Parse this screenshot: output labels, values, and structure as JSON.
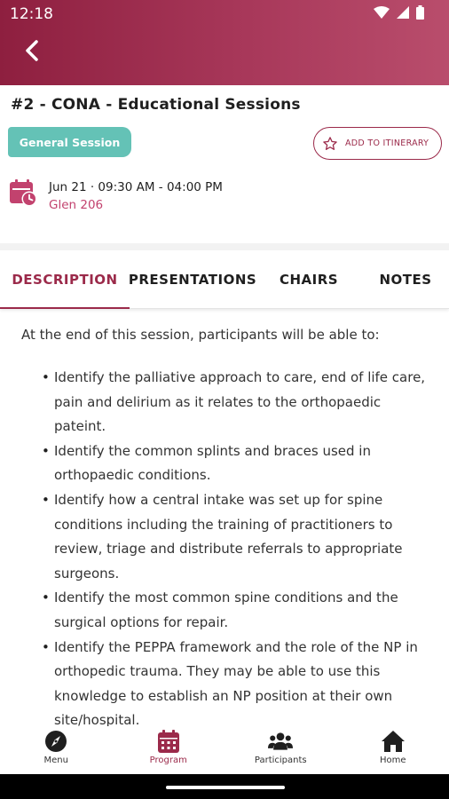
{
  "status_bar": {
    "time": "12:18"
  },
  "session": {
    "title": "#2 - CONA - Educational Sessions",
    "badge": "General Session",
    "itinerary_button": "ADD TO ITINERARY",
    "datetime": "Jun 21 · 09:30 AM - 04:00 PM",
    "location": "Glen 206"
  },
  "tabs": [
    {
      "label": "DESCRIPTION",
      "active": true
    },
    {
      "label": "PRESENTATIONS",
      "active": false
    },
    {
      "label": "CHAIRS",
      "active": false
    },
    {
      "label": "NOTES",
      "active": false
    }
  ],
  "description": {
    "intro": "At the end of this session, participants will be able to:",
    "bullets": [
      "Identify the palliative approach to care, end of life care, pain and delirium as it relates to the orthopaedic pateint.",
      "Identify the common splints and braces used in orthopaedic conditions.",
      "Identify how a central intake was set up for spine conditions including the training of practitioners to review, triage and distribute referrals to appropriate surgeons.",
      "Identify the most common spine conditions and the surgical options for repair.",
      "Identify the PEPPA framework and the role of the NP in orthopedic trauma. They may be able to use this knowledge to establish an NP position at their own site/hospital."
    ]
  },
  "bottom_nav": [
    {
      "label": "Menu",
      "icon": "compass-icon",
      "active": false
    },
    {
      "label": "Program",
      "icon": "calendar-icon",
      "active": true
    },
    {
      "label": "Participants",
      "icon": "people-icon",
      "active": false
    },
    {
      "label": "Home",
      "icon": "home-icon",
      "active": false
    }
  ],
  "colors": {
    "primary": "#9b2a4a",
    "badge": "#64c2b6",
    "location": "#c2426e"
  }
}
